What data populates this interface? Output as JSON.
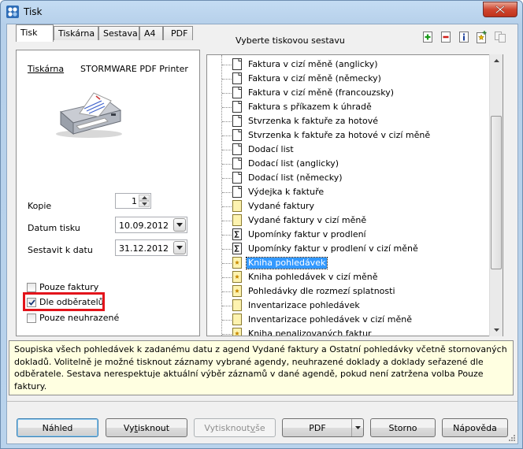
{
  "window": {
    "title": "Tisk"
  },
  "tabs": [
    {
      "label": "Tisk",
      "active": true
    },
    {
      "label": "Tiskárna",
      "active": false
    },
    {
      "label": "Sestava",
      "active": false
    },
    {
      "label": "A4",
      "active": false
    },
    {
      "label": "PDF",
      "active": false
    }
  ],
  "report_heading": "Vyberte tiskovou sestavu",
  "printer": {
    "label": "Tiskárna",
    "value": "STORMWARE PDF Printer"
  },
  "copies": {
    "label": "Kopie",
    "value": "1"
  },
  "print_date": {
    "label": "Datum tisku",
    "value": "10.09.2012"
  },
  "compile_date": {
    "label": "Sestavit k datu",
    "value": "31.12.2012"
  },
  "options": [
    {
      "label": "Pouze faktury",
      "checked": false
    },
    {
      "label": "Dle odběratelů",
      "checked": true
    },
    {
      "label": "Pouze neuhrazené",
      "checked": false
    }
  ],
  "reports": [
    {
      "label": "Faktura v cizí měně (anglicky)",
      "icon": "document-icon"
    },
    {
      "label": "Faktura v cizí měně (německy)",
      "icon": "document-icon"
    },
    {
      "label": "Faktura v cizí měně (francouzsky)",
      "icon": "document-icon"
    },
    {
      "label": "Faktura s příkazem k úhradě",
      "icon": "document-icon"
    },
    {
      "label": "Stvrzenka k faktuře za hotové",
      "icon": "document-icon"
    },
    {
      "label": "Stvrzenka k faktuře za hotové v cizí měně",
      "icon": "document-icon"
    },
    {
      "label": "Dodací list",
      "icon": "document-icon"
    },
    {
      "label": "Dodací list (anglicky)",
      "icon": "document-icon"
    },
    {
      "label": "Dodací list (německy)",
      "icon": "document-icon"
    },
    {
      "label": "Výdejka k faktuře",
      "icon": "document-icon"
    },
    {
      "label": "Vydané faktury",
      "icon": "yellow-document-icon"
    },
    {
      "label": "Vydané faktury v cizí měně",
      "icon": "yellow-document-icon"
    },
    {
      "label": "Upomínky faktur v prodlení",
      "icon": "sum-document-icon"
    },
    {
      "label": "Upomínky faktur v prodlení v cizí měně",
      "icon": "sum-document-icon"
    },
    {
      "label": "Kniha pohledávek",
      "icon": "star-document-icon",
      "selected": true
    },
    {
      "label": "Kniha pohledávek v cizí měně",
      "icon": "star-document-icon"
    },
    {
      "label": "Pohledávky dle rozmezí splatnosti",
      "icon": "star-document-icon"
    },
    {
      "label": "Inventarizace pohledávek",
      "icon": "yellow-document-icon"
    },
    {
      "label": "Inventarizace pohledávek v cizí měně",
      "icon": "yellow-document-icon"
    },
    {
      "label": "Kniha penalizovaných faktur",
      "icon": "star-document-icon"
    }
  ],
  "description": "Soupiska všech pohledávek k zadanému datu z agend Vydané faktury a Ostatní pohledávky včetně stornovaných dokladů. Volitelně je možné tisknout záznamy vybrané agendy, neuhrazené doklady a doklady seřazené dle odběratele. Sestava nerespektuje aktuální výběr záznamů v dané agendě, pokud není zatržena volba Pouze faktury.",
  "buttons": {
    "preview": {
      "pre": "Náhled",
      "ul": "",
      "post": ""
    },
    "print": {
      "pre": "Vy",
      "ul": "t",
      "post": "isknout"
    },
    "print_all": {
      "pre": "Vytisknout ",
      "ul": "v",
      "post": "še"
    },
    "pdf": "PDF",
    "cancel": "Storno",
    "help": "Nápověda"
  },
  "colors": {
    "selection": "#3399ff",
    "highlight_box": "#e3141b",
    "description_bg": "#ffffe1"
  }
}
